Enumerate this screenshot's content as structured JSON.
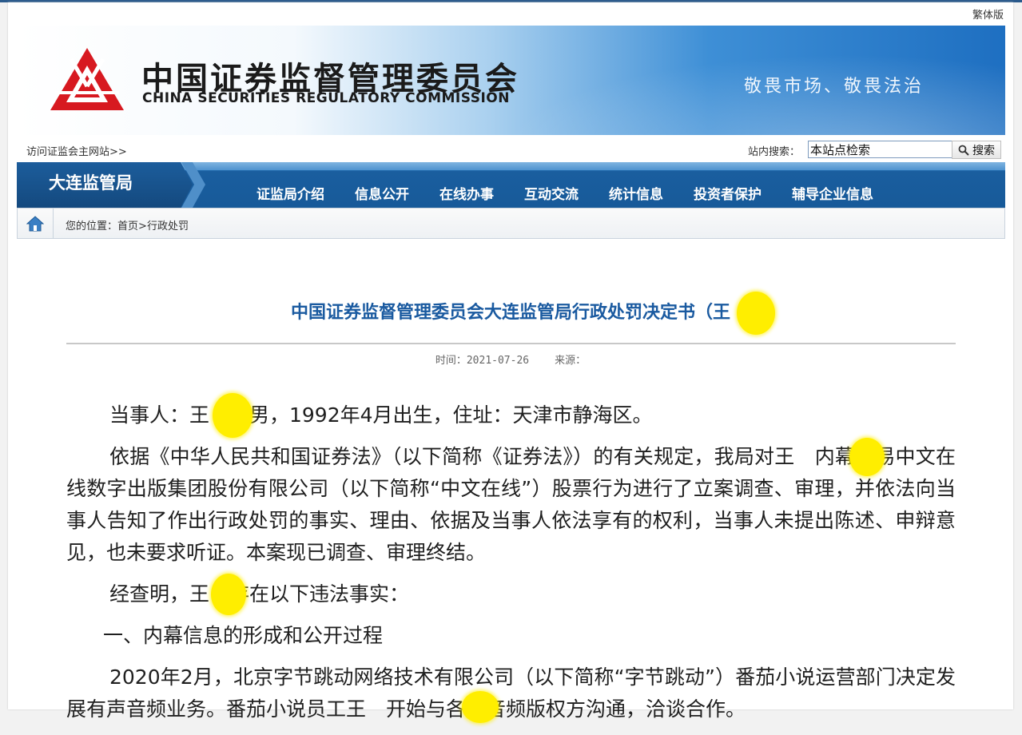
{
  "top": {
    "traditional_label": "繁体版"
  },
  "banner": {
    "cn_title": "中国证券监督管理委员会",
    "en_title": "CHINA SECURITIES REGULATORY COMMISSION",
    "slogan": "敬畏市场、敬畏法治",
    "logo_icon": "csrc-logo-icon"
  },
  "linkbar": {
    "main_site_link": "访问证监会主网站>>",
    "search_label": "站内搜索：",
    "search_value": "本站点检索",
    "search_button": "搜索"
  },
  "nav": {
    "branch": "大连监管局",
    "items": [
      "证监局介绍",
      "信息公开",
      "在线办事",
      "互动交流",
      "统计信息",
      "投资者保护",
      "辅导企业信息"
    ]
  },
  "breadcrumb": {
    "prefix": "您的位置：",
    "home": "首页",
    "sep": ">",
    "current": "行政处罚"
  },
  "article": {
    "title": "中国证券监督管理委员会大连监管局行政处罚决定书（王",
    "time_label": "时间：2021-07-26",
    "source_label": "来源：",
    "paragraphs": [
      "当事人：王　　男，1992年4月出生，住址：天津市静海区。",
      "依据《中华人民共和国证券法》（以下简称《证券法》）的有关规定，我局对王　内幕交易中文在线数字出版集团股份有限公司（以下简称“中文在线”）股票行为进行了立案调查、审理，并依法向当事人告知了作出行政处罚的事实、理由、依据及当事人依法享有的权利，当事人未提出陈述、申辩意见，也未要求听证。本案现已调查、审理终结。",
      "经查明，王　存在以下违法事实：",
      "一、内幕信息的形成和公开过程",
      "2020年2月，北京字节跳动网络技术有限公司（以下简称“字节跳动”）番茄小说运营部门决定发展有声音频业务。番茄小说员工王　开始与各家音频版权方沟通，洽谈合作。"
    ]
  },
  "colors": {
    "title_blue": "#1a5aa0",
    "nav_blue": "#175a99",
    "redaction_yellow": "#ffee00"
  }
}
